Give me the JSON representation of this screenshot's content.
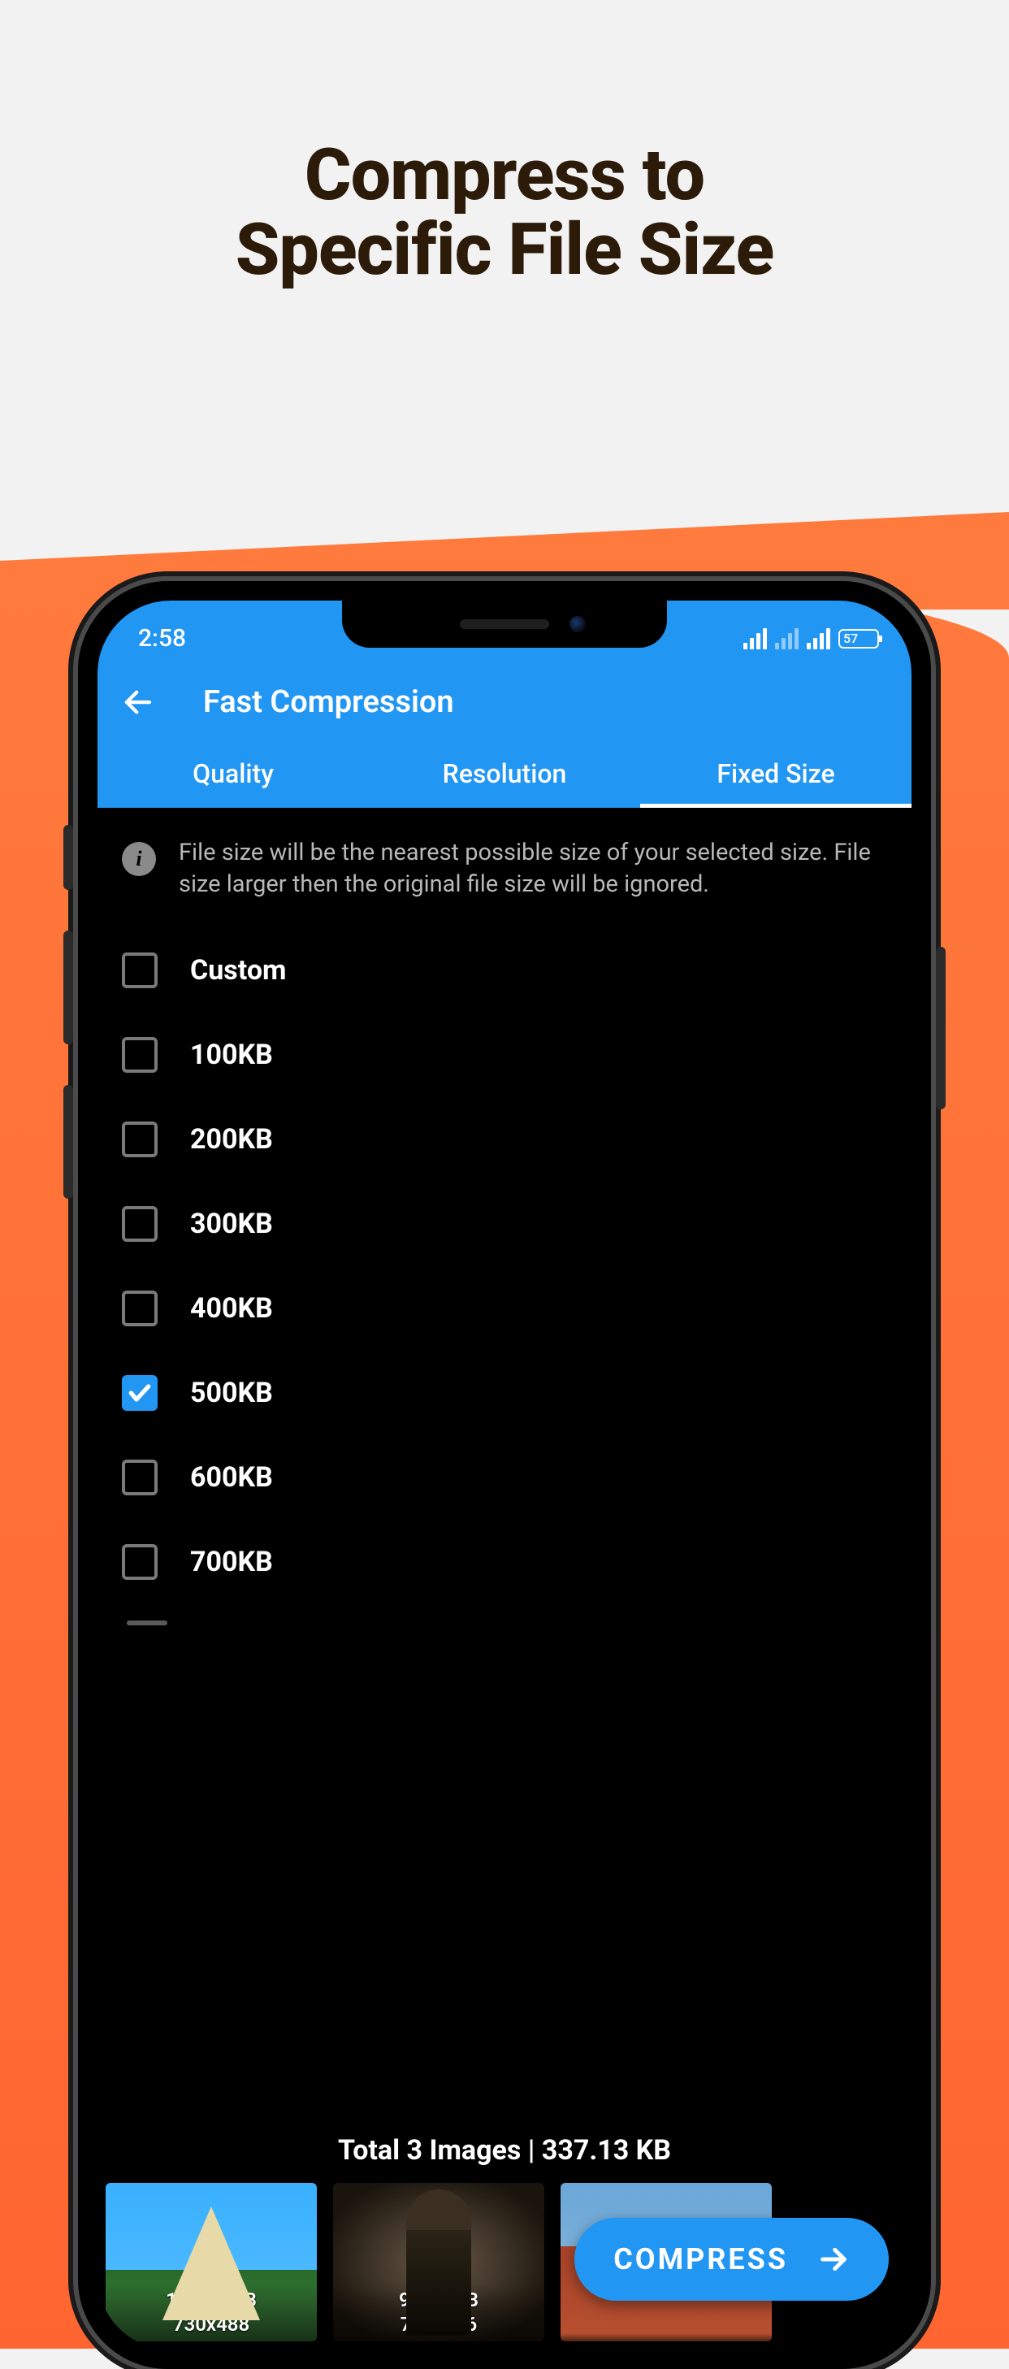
{
  "promo": {
    "line1": "Compress to",
    "line2": "Specific File Size"
  },
  "status": {
    "time": "2:58",
    "battery": "57"
  },
  "header": {
    "title": "Fast Compression"
  },
  "tabs": [
    {
      "label": "Quality",
      "active": false
    },
    {
      "label": "Resolution",
      "active": false
    },
    {
      "label": "Fixed Size",
      "active": true
    }
  ],
  "info_text": "File size will be the nearest possible size of your selected size. File size larger then the original file size will be ignored.",
  "sizes": [
    {
      "label": "Custom",
      "checked": false
    },
    {
      "label": "100KB",
      "checked": false
    },
    {
      "label": "200KB",
      "checked": false
    },
    {
      "label": "300KB",
      "checked": false
    },
    {
      "label": "400KB",
      "checked": false
    },
    {
      "label": "500KB",
      "checked": true
    },
    {
      "label": "600KB",
      "checked": false
    },
    {
      "label": "700KB",
      "checked": false
    }
  ],
  "summary": "Total 3 Images | 337.13 KB",
  "thumbnails": [
    {
      "size": "120.93 KB",
      "dims": "730x488"
    },
    {
      "size": "99.92 KB",
      "dims": "730x526"
    },
    {
      "size": "",
      "dims": ""
    }
  ],
  "compress_label": "COMPRESS"
}
